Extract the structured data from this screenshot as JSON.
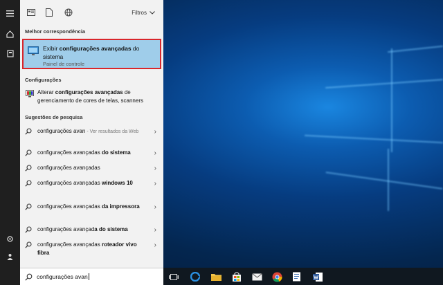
{
  "filter_bar": {
    "filters_label": "Filtros",
    "icons": [
      "apps-icon",
      "document-icon",
      "web-globe-icon"
    ]
  },
  "best_match": {
    "heading": "Melhor correspondência",
    "title_prefix": "Exibir ",
    "title_bold": "configurações avançadas",
    "title_suffix": " do sistema",
    "subtitle": "Painel de controle"
  },
  "settings_section": {
    "heading": "Configurações",
    "item_prefix": "Alterar ",
    "item_bold": "configurações avançadas",
    "item_suffix": " de gerenciamento de cores de telas, scanners"
  },
  "suggestions": {
    "heading": "Sugestões de pesquisa",
    "items": [
      {
        "query": "configurações avan",
        "bold": "",
        "sub": " - Ver resultados da Web"
      },
      {
        "query": "configurações avançadas",
        "bold": " do sistema",
        "sub": ""
      },
      {
        "query": "configurações avançadas",
        "bold": "",
        "sub": ""
      },
      {
        "query": "configurações avançadas",
        "bold": " windows 10",
        "sub": ""
      },
      {
        "query": "configurações avançadas",
        "bold": " da impressora",
        "sub": ""
      },
      {
        "query": "configurações avançad",
        "bold": "a do sistema",
        "sub": ""
      },
      {
        "query": "configurações avançadas",
        "bold": " roteador vivo fibra",
        "sub": ""
      }
    ]
  },
  "search": {
    "value": "configurações avan"
  },
  "colors": {
    "selected_bg": "#9fcdea",
    "highlight_border": "#d9262b",
    "panel_bg": "#f2f2f2",
    "rail_bg": "#1f1f1f"
  }
}
